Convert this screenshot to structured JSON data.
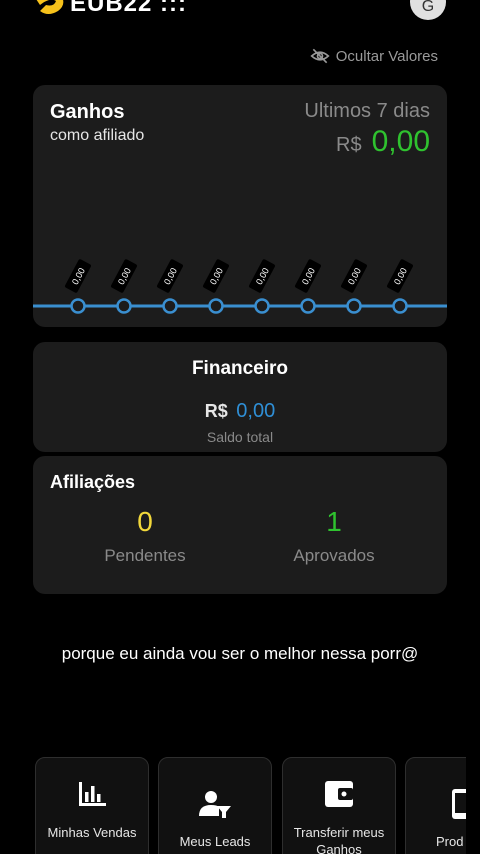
{
  "header": {
    "logo_text": "EUB22 :::",
    "avatar_initial": "G"
  },
  "hide_values_label": "Ocultar Valores",
  "ganhos": {
    "title": "Ganhos",
    "subtitle": "como afiliado",
    "period": "Ultimos 7 dias",
    "currency": "R$",
    "total": "0,00"
  },
  "chart_data": {
    "type": "line",
    "points": 8,
    "data_labels": [
      "0,00",
      "0,00",
      "0,00",
      "0,00",
      "0,00",
      "0,00",
      "0,00",
      "0,00"
    ],
    "values": [
      0,
      0,
      0,
      0,
      0,
      0,
      0,
      0
    ],
    "line_color": "#3a8fd0"
  },
  "financeiro": {
    "title": "Financeiro",
    "currency": "R$",
    "value": "0,00",
    "label": "Saldo total"
  },
  "afiliacoes": {
    "title": "Afiliações",
    "pendentes_value": "0",
    "pendentes_label": "Pendentes",
    "aprovados_value": "1",
    "aprovados_label": "Aprovados"
  },
  "caption": "porque eu ainda vou ser o melhor nessa porr@",
  "menu": {
    "items": [
      {
        "label": "Minhas Vendas",
        "icon": "bar-chart-icon"
      },
      {
        "label": "Meus Leads",
        "icon": "person-filter-icon"
      },
      {
        "label": "Transferir meus Ganhos",
        "icon": "wallet-icon"
      },
      {
        "label": "Prod",
        "icon": "phone-icon"
      }
    ]
  },
  "colors": {
    "positive": "#2fc22f",
    "accent_blue": "#2f8fd6",
    "pending": "#f2d83b"
  }
}
